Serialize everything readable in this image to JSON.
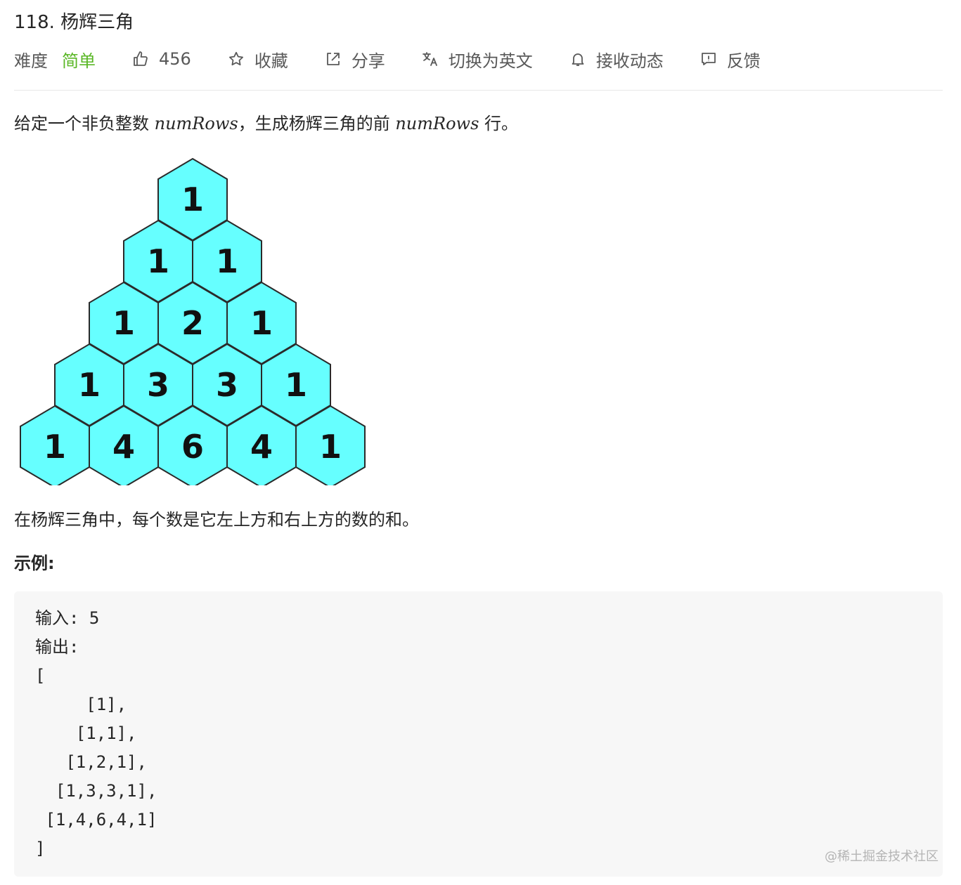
{
  "problem": {
    "title": "118. 杨辉三角",
    "difficulty_label": "难度",
    "difficulty_value": "简单"
  },
  "actions": {
    "like_count": "456",
    "favorite_label": "收藏",
    "share_label": "分享",
    "translate_label": "切换为英文",
    "subscribe_label": "接收动态",
    "feedback_label": "反馈"
  },
  "description": {
    "text_1": "给定一个非负整数 ",
    "var_1": "numRows",
    "text_2": "，生成杨辉三角的前 ",
    "var_2": "numRows",
    "text_3": " 行。"
  },
  "figure": {
    "fill_color": "#66ffff",
    "stroke_color": "#2a2a2a",
    "rows": [
      [
        1
      ],
      [
        1,
        1
      ],
      [
        1,
        2,
        1
      ],
      [
        1,
        3,
        3,
        1
      ],
      [
        1,
        4,
        6,
        4,
        1
      ]
    ]
  },
  "note": "在杨辉三角中，每个数是它左上方和右上方的数的和。",
  "example": {
    "heading": "示例:",
    "lines": [
      "输入: 5",
      "输出:",
      "[",
      "     [1],",
      "    [1,1],",
      "   [1,2,1],",
      "  [1,3,3,1],",
      " [1,4,6,4,1]",
      "]"
    ]
  },
  "watermark": "@稀土掘金技术社区",
  "colors": {
    "easy": "#5ab726",
    "code_bg": "#f7f7f7",
    "text": "#262626"
  }
}
